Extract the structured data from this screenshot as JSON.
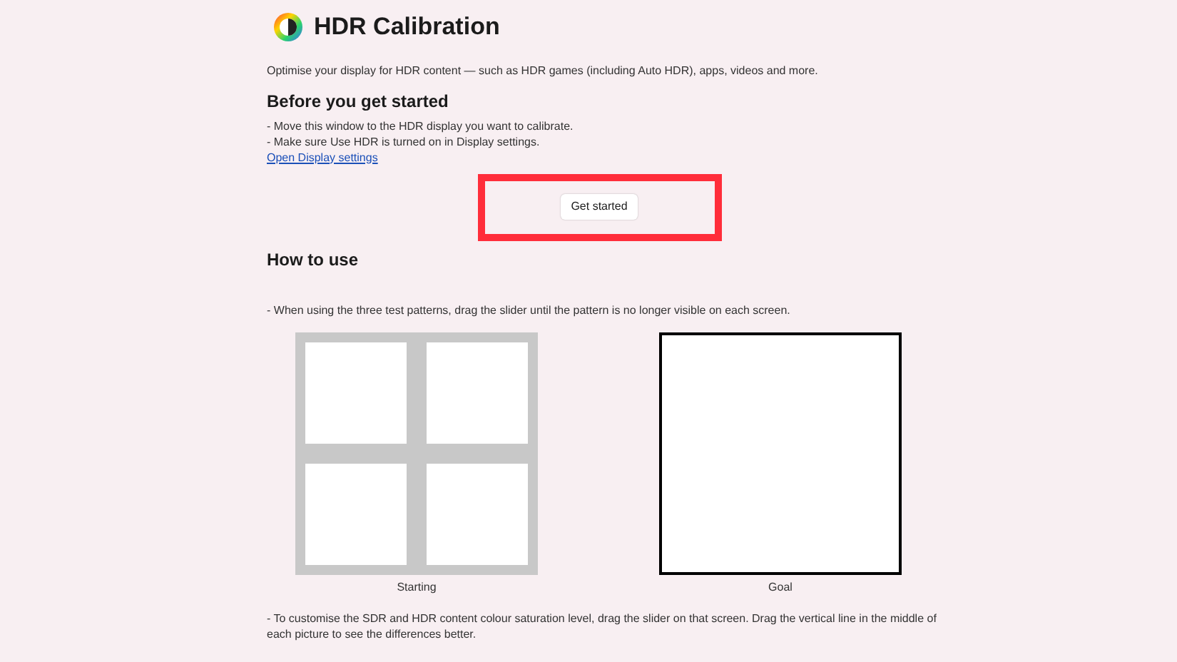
{
  "title": "HDR Calibration",
  "intro": "Optimise your display for HDR content — such as HDR games (including Auto HDR), apps, videos and more.",
  "before": {
    "heading": "Before you get started",
    "lines": [
      "- Move this window to the HDR display you want to calibrate.",
      "- Make sure Use HDR is turned on in Display settings."
    ],
    "link": "Open Display settings"
  },
  "button": {
    "label": "Get started",
    "highlighted": true
  },
  "how": {
    "heading": "How to use",
    "instruction": "- When using the three test patterns, drag the slider until the pattern is no longer visible on each screen.",
    "patterns": [
      {
        "kind": "grid",
        "caption": "Starting"
      },
      {
        "kind": "blank",
        "caption": "Goal"
      }
    ],
    "note": "- To customise the SDR and HDR content colour saturation level, drag the slider on that screen. Drag the vertical line in the middle of each picture to see the differences better."
  }
}
